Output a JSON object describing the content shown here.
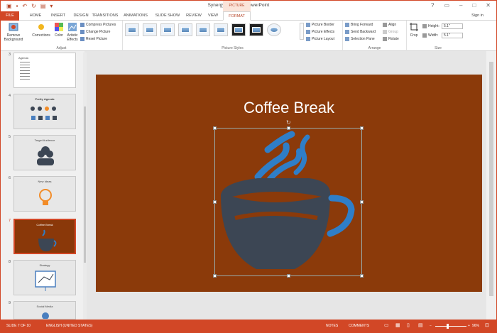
{
  "window": {
    "title": "Synergy Summit - PowerPoint",
    "context_tab_group": "PICTURE TOOLS",
    "sign_in": "Sign in"
  },
  "tabs": [
    "FILE",
    "HOME",
    "INSERT",
    "DESIGN",
    "TRANSITIONS",
    "ANIMATIONS",
    "SLIDE SHOW",
    "REVIEW",
    "VIEW",
    "FORMAT"
  ],
  "ribbon": {
    "adjust": {
      "label": "Adjust",
      "remove_bg": "Remove Background",
      "corrections": "Corrections",
      "color": "Color",
      "artistic": "Artistic Effects",
      "compress": "Compress Pictures",
      "change": "Change Picture",
      "reset": "Reset Picture"
    },
    "styles": {
      "label": "Picture Styles",
      "border": "Picture Border",
      "effects": "Picture Effects",
      "layout": "Picture Layout"
    },
    "arrange": {
      "label": "Arrange",
      "forward": "Bring Forward",
      "backward": "Send Backward",
      "pane": "Selection Pane",
      "align": "Align",
      "group": "Group",
      "rotate": "Rotate"
    },
    "size": {
      "label": "Size",
      "crop": "Crop",
      "height_label": "Height:",
      "height": "5.1\"",
      "width_label": "Width:",
      "width": "5.1\""
    }
  },
  "slides": [
    {
      "num": "3",
      "title": "Agenda"
    },
    {
      "num": "4",
      "title": "Pretty Agenda"
    },
    {
      "num": "5",
      "title": "Target Audience"
    },
    {
      "num": "6",
      "title": "New Ideas"
    },
    {
      "num": "7",
      "title": "Coffee Break"
    },
    {
      "num": "8",
      "title": "Strategy"
    },
    {
      "num": "9",
      "title": "Social Media"
    }
  ],
  "main_slide": {
    "title": "Coffee Break",
    "bg": "#8b3a0a",
    "cup_color": "#3c4654",
    "steam_color": "#2f7ec7"
  },
  "status": {
    "slide": "SLIDE 7 OF 10",
    "language": "ENGLISH (UNITED STATES)",
    "notes": "NOTES",
    "comments": "COMMENTS",
    "zoom": "96%"
  },
  "colors": {
    "accent": "#d24726"
  }
}
